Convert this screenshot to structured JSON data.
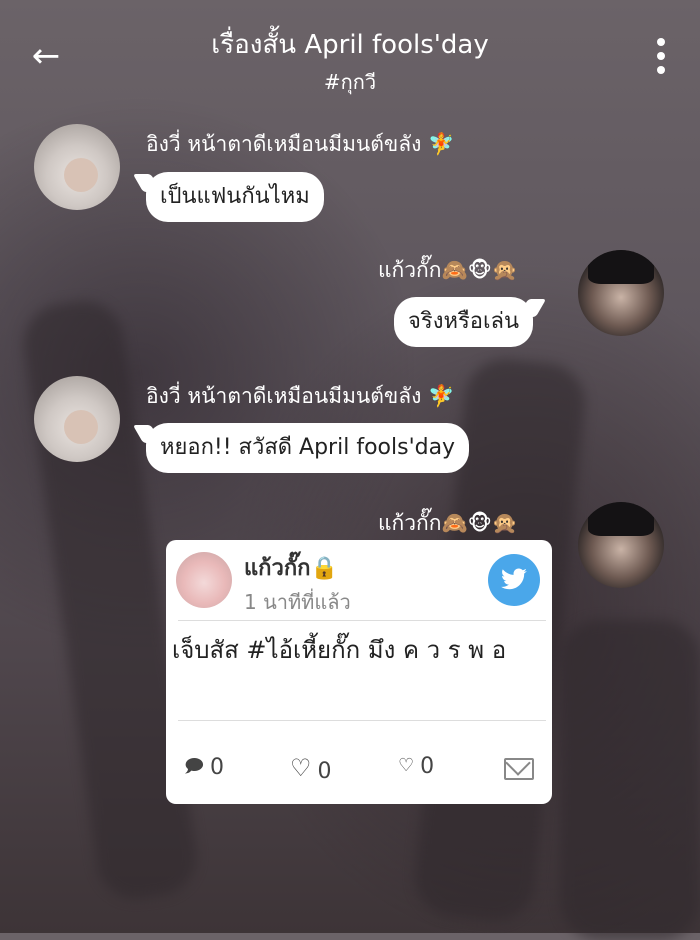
{
  "header": {
    "back_icon": "←",
    "title": "เรื่องสั้น April fools'day",
    "subtitle": "#กุกวี"
  },
  "messages": [
    {
      "sender": "อิงวี่ หน้าตาดีเหมือนมีมนต์ขลัง 🧚",
      "text": "เป็นแฟนกันไหม",
      "side": "left"
    },
    {
      "sender": "แก้วกั๊ก🙈🐵🙊",
      "text": "จริงหรือเล่น",
      "side": "right"
    },
    {
      "sender": "อิงวี่ หน้าตาดีเหมือนมีมนต์ขลัง 🧚",
      "text": "หยอก!! สวัสดี April fools'day",
      "side": "left"
    },
    {
      "sender": "แก้วกั๊ก🙈🐵🙊",
      "side": "right"
    }
  ],
  "tweet_card": {
    "author": "แก้วกั๊ก🔒",
    "time": "1 นาทีที่แล้ว",
    "text": "เจ็บสัส #ไอ้เหี้ยกั๊ก มึง ค ว ร พ อ",
    "twitter_icon": "bird",
    "stats": {
      "replies": "0",
      "likes": "0",
      "small_likes": "0"
    }
  },
  "colors": {
    "twitter": "#4aa7ea",
    "bubble": "#ffffff"
  }
}
